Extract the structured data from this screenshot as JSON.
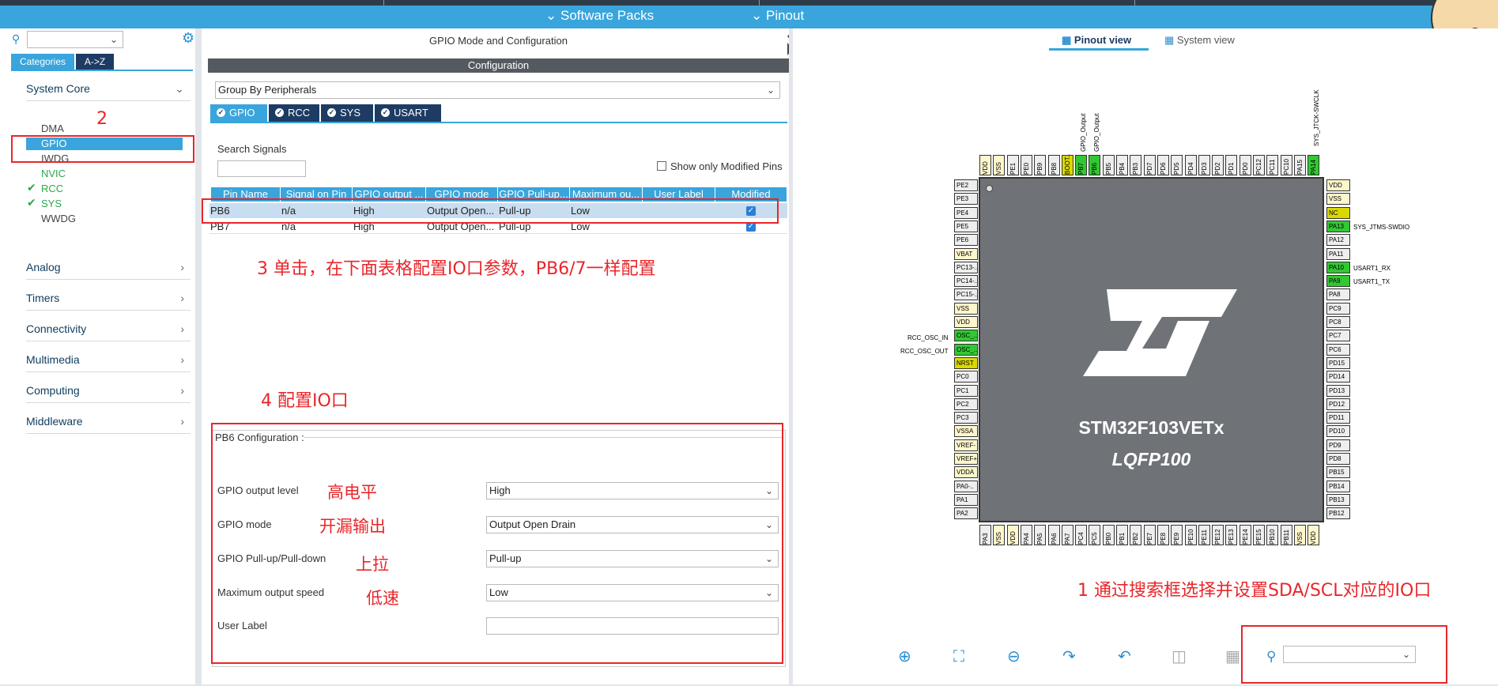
{
  "topbar": {
    "software_packs": "Software Packs",
    "pinout": "Pinout"
  },
  "left": {
    "search_value": "",
    "tab_categories": "Categories",
    "tab_az": "A->Z",
    "system_core": "System Core",
    "sub_items": [
      "DMA",
      "GPIO",
      "IWDG",
      "NVIC",
      "RCC",
      "SYS",
      "WWDG"
    ],
    "categories": [
      "Analog",
      "Timers",
      "Connectivity",
      "Multimedia",
      "Computing",
      "Middleware"
    ]
  },
  "middle": {
    "title": "GPIO Mode and Configuration",
    "config_header": "Configuration",
    "group_by": "Group By Peripherals",
    "tabs": [
      "GPIO",
      "RCC",
      "SYS",
      "USART"
    ],
    "search_signals": "Search Signals",
    "show_modified": "Show only Modified Pins",
    "columns": [
      "Pin Name",
      "Signal on Pin",
      "GPIO output ...",
      "GPIO mode",
      "GPIO Pull-up...",
      "Maximum ou...",
      "User Label",
      "Modified"
    ],
    "rows": [
      [
        "PB6",
        "n/a",
        "High",
        "Output Open...",
        "Pull-up",
        "Low",
        ""
      ],
      [
        "PB7",
        "n/a",
        "High",
        "Output Open...",
        "Pull-up",
        "Low",
        ""
      ]
    ],
    "pb6_config": "PB6 Configuration :",
    "fields": [
      {
        "label": "GPIO output level",
        "value": "High"
      },
      {
        "label": "GPIO mode",
        "value": "Output Open Drain"
      },
      {
        "label": "GPIO Pull-up/Pull-down",
        "value": "Pull-up"
      },
      {
        "label": "Maximum output speed",
        "value": "Low"
      },
      {
        "label": "User Label",
        "value": ""
      }
    ]
  },
  "annotations": {
    "a1": "1 通过搜索框选择并设置SDA/SCL对应的IO口",
    "a2": "2",
    "a3": "3 单击，在下面表格配置IO口参数，PB6/7一样配置",
    "a4": "4 配置IO口",
    "high": "高电平",
    "open_drain": "开漏输出",
    "pullup": "上拉",
    "low": "低速"
  },
  "right": {
    "pinout_view": "Pinout view",
    "system_view": "System view",
    "chip_name": "STM32F103VETx",
    "package": "LQFP100",
    "top_pins": [
      "VDD",
      "VSS",
      "PE1",
      "PE0",
      "PB9",
      "PB8",
      "BOOT..",
      "PB7",
      "PB6",
      "PB5",
      "PB4",
      "PB3",
      "PD7",
      "PD6",
      "PD5",
      "PD4",
      "PD3",
      "PD2",
      "PD1",
      "PD0",
      "PC12",
      "PC11",
      "PC10",
      "PA15",
      "PA14"
    ],
    "top_labels": [
      "GPIO_Output",
      "GPIO_Output",
      "SYS_JTCK-SWCLK"
    ],
    "left_pins": [
      "PE2",
      "PE3",
      "PE4",
      "PE5",
      "PE6",
      "VBAT",
      "PC13-..",
      "PC14-..",
      "PC15-..",
      "VSS",
      "VDD",
      "OSC_..",
      "OSC_..",
      "NRST",
      "PC0",
      "PC1",
      "PC2",
      "PC3",
      "VSSA",
      "VREF-",
      "VREF+",
      "VDDA",
      "PA0-..",
      "PA1",
      "PA2"
    ],
    "left_labels": [
      "RCC_OSC_IN",
      "RCC_OSC_OUT"
    ],
    "right_pins": [
      "VDD",
      "VSS",
      "NC",
      "PA13",
      "PA12",
      "PA11",
      "PA10",
      "PA9",
      "PA8",
      "PC9",
      "PC8",
      "PC7",
      "PC6",
      "PD15",
      "PD14",
      "PD13",
      "PD12",
      "PD11",
      "PD10",
      "PD9",
      "PD8",
      "PB15",
      "PB14",
      "PB13",
      "PB12"
    ],
    "right_labels": [
      "SYS_JTMS-SWDIO",
      "USART1_RX",
      "USART1_TX"
    ],
    "bottom_pins": [
      "PA3",
      "VSS",
      "VDD",
      "PA4",
      "PA5",
      "PA6",
      "PA7",
      "PC4",
      "PC5",
      "PB0",
      "PB1",
      "PB2",
      "PE7",
      "PE8",
      "PE9",
      "PE10",
      "PE11",
      "PE12",
      "PE13",
      "PE14",
      "PE15",
      "PB10",
      "PB11",
      "VSS",
      "VDD"
    ],
    "search_value": ""
  },
  "colors": {
    "accent": "#39a5dc",
    "dark_tab": "#1e3c63",
    "pin_green": "#32c832",
    "pin_yellow": "#d9d900",
    "pin_cream": "#fff7cc",
    "annotation_red": "#e8262a"
  }
}
